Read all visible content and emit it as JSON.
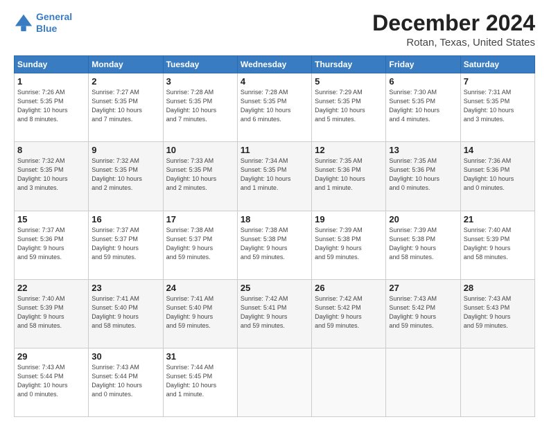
{
  "header": {
    "logo_line1": "General",
    "logo_line2": "Blue",
    "month": "December 2024",
    "location": "Rotan, Texas, United States"
  },
  "weekdays": [
    "Sunday",
    "Monday",
    "Tuesday",
    "Wednesday",
    "Thursday",
    "Friday",
    "Saturday"
  ],
  "weeks": [
    [
      {
        "day": "1",
        "info": "Sunrise: 7:26 AM\nSunset: 5:35 PM\nDaylight: 10 hours\nand 8 minutes."
      },
      {
        "day": "2",
        "info": "Sunrise: 7:27 AM\nSunset: 5:35 PM\nDaylight: 10 hours\nand 7 minutes."
      },
      {
        "day": "3",
        "info": "Sunrise: 7:28 AM\nSunset: 5:35 PM\nDaylight: 10 hours\nand 7 minutes."
      },
      {
        "day": "4",
        "info": "Sunrise: 7:28 AM\nSunset: 5:35 PM\nDaylight: 10 hours\nand 6 minutes."
      },
      {
        "day": "5",
        "info": "Sunrise: 7:29 AM\nSunset: 5:35 PM\nDaylight: 10 hours\nand 5 minutes."
      },
      {
        "day": "6",
        "info": "Sunrise: 7:30 AM\nSunset: 5:35 PM\nDaylight: 10 hours\nand 4 minutes."
      },
      {
        "day": "7",
        "info": "Sunrise: 7:31 AM\nSunset: 5:35 PM\nDaylight: 10 hours\nand 3 minutes."
      }
    ],
    [
      {
        "day": "8",
        "info": "Sunrise: 7:32 AM\nSunset: 5:35 PM\nDaylight: 10 hours\nand 3 minutes."
      },
      {
        "day": "9",
        "info": "Sunrise: 7:32 AM\nSunset: 5:35 PM\nDaylight: 10 hours\nand 2 minutes."
      },
      {
        "day": "10",
        "info": "Sunrise: 7:33 AM\nSunset: 5:35 PM\nDaylight: 10 hours\nand 2 minutes."
      },
      {
        "day": "11",
        "info": "Sunrise: 7:34 AM\nSunset: 5:35 PM\nDaylight: 10 hours\nand 1 minute."
      },
      {
        "day": "12",
        "info": "Sunrise: 7:35 AM\nSunset: 5:36 PM\nDaylight: 10 hours\nand 1 minute."
      },
      {
        "day": "13",
        "info": "Sunrise: 7:35 AM\nSunset: 5:36 PM\nDaylight: 10 hours\nand 0 minutes."
      },
      {
        "day": "14",
        "info": "Sunrise: 7:36 AM\nSunset: 5:36 PM\nDaylight: 10 hours\nand 0 minutes."
      }
    ],
    [
      {
        "day": "15",
        "info": "Sunrise: 7:37 AM\nSunset: 5:36 PM\nDaylight: 9 hours\nand 59 minutes."
      },
      {
        "day": "16",
        "info": "Sunrise: 7:37 AM\nSunset: 5:37 PM\nDaylight: 9 hours\nand 59 minutes."
      },
      {
        "day": "17",
        "info": "Sunrise: 7:38 AM\nSunset: 5:37 PM\nDaylight: 9 hours\nand 59 minutes."
      },
      {
        "day": "18",
        "info": "Sunrise: 7:38 AM\nSunset: 5:38 PM\nDaylight: 9 hours\nand 59 minutes."
      },
      {
        "day": "19",
        "info": "Sunrise: 7:39 AM\nSunset: 5:38 PM\nDaylight: 9 hours\nand 59 minutes."
      },
      {
        "day": "20",
        "info": "Sunrise: 7:39 AM\nSunset: 5:38 PM\nDaylight: 9 hours\nand 58 minutes."
      },
      {
        "day": "21",
        "info": "Sunrise: 7:40 AM\nSunset: 5:39 PM\nDaylight: 9 hours\nand 58 minutes."
      }
    ],
    [
      {
        "day": "22",
        "info": "Sunrise: 7:40 AM\nSunset: 5:39 PM\nDaylight: 9 hours\nand 58 minutes."
      },
      {
        "day": "23",
        "info": "Sunrise: 7:41 AM\nSunset: 5:40 PM\nDaylight: 9 hours\nand 58 minutes."
      },
      {
        "day": "24",
        "info": "Sunrise: 7:41 AM\nSunset: 5:40 PM\nDaylight: 9 hours\nand 59 minutes."
      },
      {
        "day": "25",
        "info": "Sunrise: 7:42 AM\nSunset: 5:41 PM\nDaylight: 9 hours\nand 59 minutes."
      },
      {
        "day": "26",
        "info": "Sunrise: 7:42 AM\nSunset: 5:42 PM\nDaylight: 9 hours\nand 59 minutes."
      },
      {
        "day": "27",
        "info": "Sunrise: 7:43 AM\nSunset: 5:42 PM\nDaylight: 9 hours\nand 59 minutes."
      },
      {
        "day": "28",
        "info": "Sunrise: 7:43 AM\nSunset: 5:43 PM\nDaylight: 9 hours\nand 59 minutes."
      }
    ],
    [
      {
        "day": "29",
        "info": "Sunrise: 7:43 AM\nSunset: 5:44 PM\nDaylight: 10 hours\nand 0 minutes."
      },
      {
        "day": "30",
        "info": "Sunrise: 7:43 AM\nSunset: 5:44 PM\nDaylight: 10 hours\nand 0 minutes."
      },
      {
        "day": "31",
        "info": "Sunrise: 7:44 AM\nSunset: 5:45 PM\nDaylight: 10 hours\nand 1 minute."
      },
      null,
      null,
      null,
      null
    ]
  ]
}
